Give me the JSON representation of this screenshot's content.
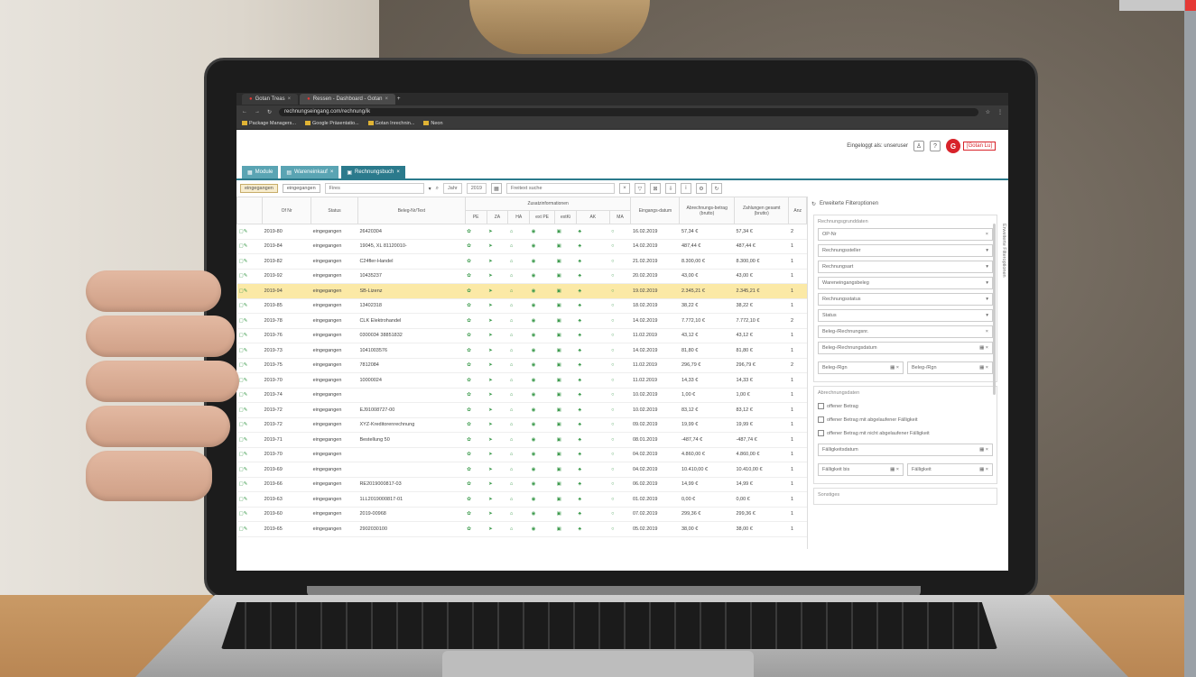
{
  "browser": {
    "tabs": [
      {
        "label": "Gotan Treas",
        "icon": "app-icon"
      },
      {
        "label": "Ressen - Dashboard - Gotan",
        "icon": "app-icon"
      }
    ],
    "url": "rechnungseingang.com/rechnung/ik",
    "bookmarks": [
      "Package Managers...",
      "Google Präsentatio...",
      "Gotan Inrechnin...",
      "Neon"
    ]
  },
  "app": {
    "user_text": "Eingeloggt als: unseruser",
    "logo_mark": "G",
    "logo_text": "[Gotan Lu]",
    "tabs": [
      "Module",
      "Wareneinkauf",
      "Rechnungsbuch"
    ],
    "active_tab": 2
  },
  "toolbar": {
    "filter_active": "eingegangen",
    "filter_other": "eingegangen",
    "filter_field": "Fires",
    "period": "Jahr",
    "year": "2019",
    "search": "Freitext suche"
  },
  "grid": {
    "columns": [
      "Of Nr",
      "Status",
      "Beleg-Nr/Text",
      "PE",
      "ZA",
      "HA",
      "ext PE",
      "extKi",
      "AK",
      "MA",
      "Eingangs-datum",
      "Abrechnungs-betrag (brutto)",
      "Zahlungen gesamt (brutto)",
      "Anz"
    ],
    "group_header": "Zusatzinformationen",
    "rows": [
      {
        "nr": "2019-80",
        "status": "eingegangen",
        "beleg": "26420304",
        "datum": "16.02.2019",
        "betrag": "57,34 €",
        "zahl": "57,34 €",
        "anz": "2",
        "hl": false
      },
      {
        "nr": "2019-84",
        "status": "eingegangen",
        "beleg": "19045, XL 81120010-",
        "datum": "14.02.2019",
        "betrag": "487,44 €",
        "zahl": "487,44 €",
        "anz": "1",
        "hl": false
      },
      {
        "nr": "2019-82",
        "status": "eingegangen",
        "beleg": "C24fler-Handel",
        "datum": "21.02.2019",
        "betrag": "8.300,00 €",
        "zahl": "8.300,00 €",
        "anz": "1",
        "hl": false
      },
      {
        "nr": "2019-92",
        "status": "eingegangen",
        "beleg": "10435237",
        "datum": "20.02.2019",
        "betrag": "43,00 €",
        "zahl": "43,00 €",
        "anz": "1",
        "hl": false
      },
      {
        "nr": "2019-94",
        "status": "eingegangen",
        "beleg": "SB-Lizenz",
        "datum": "19.02.2019",
        "betrag": "2.345,21 €",
        "zahl": "2.345,21 €",
        "anz": "1",
        "hl": true
      },
      {
        "nr": "2019-85",
        "status": "eingegangen",
        "beleg": "13402318",
        "datum": "18.02.2019",
        "betrag": "38,22 €",
        "zahl": "38,22 €",
        "anz": "1",
        "hl": false
      },
      {
        "nr": "2019-78",
        "status": "eingegangen",
        "beleg": "CLK Elektrohandel",
        "datum": "14.02.2019",
        "betrag": "7.772,10 €",
        "zahl": "7.772,10 €",
        "anz": "2",
        "hl": false
      },
      {
        "nr": "2019-76",
        "status": "eingegangen",
        "beleg": "0300034 38851832",
        "datum": "11.02.2019",
        "betrag": "43,12 €",
        "zahl": "43,12 €",
        "anz": "1",
        "hl": false
      },
      {
        "nr": "2019-73",
        "status": "eingegangen",
        "beleg": "1041003576",
        "datum": "14.02.2019",
        "betrag": "81,80 €",
        "zahl": "81,80 €",
        "anz": "1",
        "hl": false
      },
      {
        "nr": "2019-75",
        "status": "eingegangen",
        "beleg": "7812084",
        "datum": "11.02.2019",
        "betrag": "296,79 €",
        "zahl": "296,79 €",
        "anz": "2",
        "hl": false
      },
      {
        "nr": "2019-70",
        "status": "eingegangen",
        "beleg": "10000024",
        "datum": "11.02.2019",
        "betrag": "14,33 €",
        "zahl": "14,33 €",
        "anz": "1",
        "hl": false
      },
      {
        "nr": "2019-74",
        "status": "eingegangen",
        "beleg": "",
        "datum": "10.02.2019",
        "betrag": "1,00 €",
        "zahl": "1,00 €",
        "anz": "1",
        "hl": false
      },
      {
        "nr": "2019-72",
        "status": "eingegangen",
        "beleg": "EJ91008727-00",
        "datum": "10.02.2019",
        "betrag": "83,12 €",
        "zahl": "83,12 €",
        "anz": "1",
        "hl": false
      },
      {
        "nr": "2019-72",
        "status": "eingegangen",
        "beleg": "XYZ-Kreditorenrechnung",
        "datum": "09.02.2019",
        "betrag": "19,99 €",
        "zahl": "19,99 €",
        "anz": "1",
        "hl": false
      },
      {
        "nr": "2019-71",
        "status": "eingegangen",
        "beleg": "Bestellung 50",
        "datum": "08.01.2019",
        "betrag": "-487,74 €",
        "zahl": "-487,74 €",
        "anz": "1",
        "hl": false
      },
      {
        "nr": "2019-70",
        "status": "eingegangen",
        "beleg": "",
        "datum": "04.02.2019",
        "betrag": "4.860,00 €",
        "zahl": "4.860,00 €",
        "anz": "1",
        "hl": false
      },
      {
        "nr": "2019-69",
        "status": "eingegangen",
        "beleg": "",
        "datum": "04.02.2019",
        "betrag": "10.410,00 €",
        "zahl": "10.410,00 €",
        "anz": "1",
        "hl": false
      },
      {
        "nr": "2019-66",
        "status": "eingegangen",
        "beleg": "RE2019000817-03",
        "datum": "06.02.2019",
        "betrag": "14,99 €",
        "zahl": "14,99 €",
        "anz": "1",
        "hl": false
      },
      {
        "nr": "2019-63",
        "status": "eingegangen",
        "beleg": "1LL2019000817-01",
        "datum": "01.02.2019",
        "betrag": "0,00 €",
        "zahl": "0,00 €",
        "anz": "1",
        "hl": false
      },
      {
        "nr": "2019-60",
        "status": "eingegangen",
        "beleg": "2019-00968",
        "datum": "07.02.2019",
        "betrag": "299,36 €",
        "zahl": "299,36 €",
        "anz": "1",
        "hl": false
      },
      {
        "nr": "2019-65",
        "status": "eingegangen",
        "beleg": "2902030100",
        "datum": "05.02.2019",
        "betrag": "38,00 €",
        "zahl": "38,00 €",
        "anz": "1",
        "hl": false
      }
    ]
  },
  "sidebar": {
    "title": "Erweiterte Filteroptionen",
    "group1": "Rechnungsgrunddaten",
    "fields": [
      "OP-Nr",
      "Rechnungssteller",
      "Rechnungsart",
      "Wareneingangsbeleg",
      "Rechnungsstatus",
      "Status",
      "Beleg-/Rechnungsnr.",
      "Beleg-/Rechnungsdatum"
    ],
    "range": [
      "Beleg-/Rgn",
      "Beleg-/Rgn"
    ],
    "group2": "Abrechnungsdaten",
    "checks": [
      "offener Betrag",
      "offener Betrag mit abgelaufener Fälligkeit",
      "offener Betrag mit nicht abgelaufener Fälligkeit"
    ],
    "due_field": "Fälligkeitsdatum",
    "due_range": [
      "Fälligkeit bis",
      "Fälligkeit"
    ],
    "group3": "Sonstiges",
    "vertical_label": "Erweiterte Filteroptionen"
  }
}
